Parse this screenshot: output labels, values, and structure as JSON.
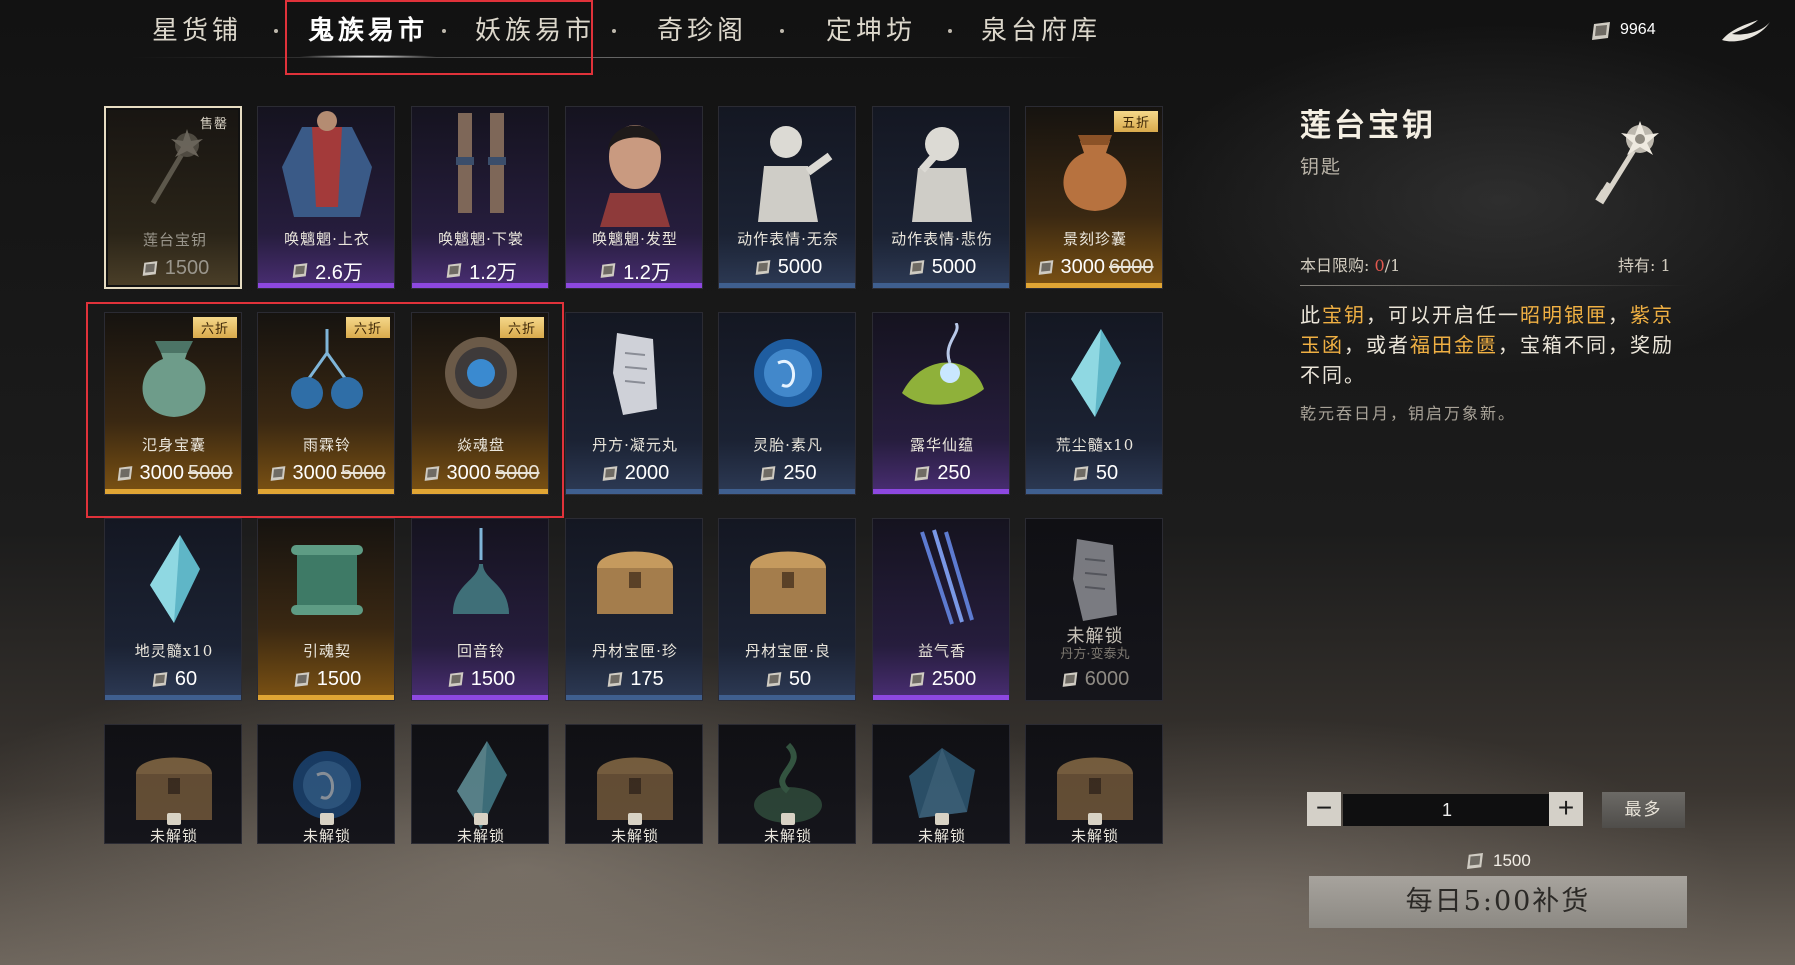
{
  "nav": {
    "tabs": [
      {
        "label": "星货铺"
      },
      {
        "label": "鬼族易市"
      },
      {
        "label": "妖族易市"
      },
      {
        "label": "奇珍阁"
      },
      {
        "label": "定坤坊"
      },
      {
        "label": "泉台府库"
      }
    ],
    "active_tab": "鬼族易市",
    "currency": "9964"
  },
  "grid": {
    "rows": [
      [
        {
          "name": "莲台宝钥",
          "price": "1500",
          "tag": "售罄",
          "rarity": "selected",
          "icon": "key-icon"
        },
        {
          "name": "唤魑魍·上衣",
          "price": "2.6万",
          "rarity": "purple",
          "icon": "outfit-top-icon"
        },
        {
          "name": "唤魑魍·下裳",
          "price": "1.2万",
          "rarity": "purple",
          "icon": "outfit-legs-icon"
        },
        {
          "name": "唤魑魍·发型",
          "price": "1.2万",
          "rarity": "purple",
          "icon": "hairstyle-icon"
        },
        {
          "name": "动作表情·无奈",
          "price": "5000",
          "rarity": "blue",
          "icon": "emote-icon"
        },
        {
          "name": "动作表情·悲伤",
          "price": "5000",
          "rarity": "blue",
          "icon": "emote-sad-icon"
        },
        {
          "name": "景刻珍囊",
          "price": "3000",
          "old_price": "6000",
          "tag": "五折",
          "rarity": "gold",
          "icon": "pouch-icon"
        }
      ],
      [
        {
          "name": "氾身宝囊",
          "price": "3000",
          "old_price": "5000",
          "tag": "六折",
          "rarity": "gold",
          "icon": "pouch-green-icon"
        },
        {
          "name": "雨霖铃",
          "price": "3000",
          "old_price": "5000",
          "tag": "六折",
          "rarity": "gold",
          "icon": "bell-orbs-icon"
        },
        {
          "name": "焱魂盘",
          "price": "3000",
          "old_price": "5000",
          "tag": "六折",
          "rarity": "gold",
          "icon": "disc-icon"
        },
        {
          "name": "丹方·凝元丸",
          "price": "2000",
          "rarity": "blue",
          "icon": "recipe-scroll-icon"
        },
        {
          "name": "灵胎·素凡",
          "price": "250",
          "rarity": "blue",
          "icon": "spirit-orb-icon"
        },
        {
          "name": "露华仙蕴",
          "price": "250",
          "rarity": "purple",
          "icon": "leaf-dew-icon"
        },
        {
          "name": "荒尘髓x10",
          "price": "50",
          "rarity": "blue",
          "icon": "crystal-icon"
        }
      ],
      [
        {
          "name": "地灵髓x10",
          "price": "60",
          "rarity": "blue",
          "icon": "crystal-icon"
        },
        {
          "name": "引魂契",
          "price": "1500",
          "rarity": "gold",
          "icon": "scroll-icon"
        },
        {
          "name": "回音铃",
          "price": "1500",
          "rarity": "purple",
          "icon": "bells-icon"
        },
        {
          "name": "丹材宝匣·珍",
          "price": "175",
          "rarity": "blue",
          "icon": "chest-icon"
        },
        {
          "name": "丹材宝匣·良",
          "price": "50",
          "rarity": "blue",
          "icon": "chest-icon"
        },
        {
          "name": "益气香",
          "price": "2500",
          "rarity": "purple",
          "icon": "incense-icon"
        },
        {
          "name": "未解锁",
          "sub": "丹方·变泰丸",
          "price": "6000",
          "rarity": "locked",
          "icon": "recipe-scroll-icon"
        }
      ],
      [
        {
          "name": "未解锁",
          "rarity": "dark",
          "icon": "chest-icon"
        },
        {
          "name": "未解锁",
          "rarity": "dark",
          "icon": "spirit-orb-icon"
        },
        {
          "name": "未解锁",
          "rarity": "dark",
          "icon": "crystal-icon"
        },
        {
          "name": "未解锁",
          "rarity": "dark",
          "icon": "chest-icon"
        },
        {
          "name": "未解锁",
          "rarity": "dark",
          "icon": "smoke-icon"
        },
        {
          "name": "未解锁",
          "rarity": "dark",
          "icon": "gem-icon"
        },
        {
          "name": "未解锁",
          "rarity": "dark",
          "icon": "chest-icon"
        }
      ]
    ]
  },
  "detail": {
    "title": "莲台宝钥",
    "category": "钥匙",
    "limit_label": "本日限购: ",
    "limit_value": "0",
    "limit_total": "/1",
    "own_label": "持有: 1",
    "desc_parts": [
      "此",
      "宝钥",
      "，可以开启任一",
      "昭明银匣",
      "，",
      "紫京玉函",
      "，或者",
      "福田金匮",
      "，宝箱不同，奖励不同。"
    ],
    "flavor": "乾元吞日月，钥启万象新。"
  },
  "purchase": {
    "minus": "−",
    "plus": "+",
    "quantity": "1",
    "max_label": "最多",
    "total": "1500",
    "button": "每日5:00补货"
  },
  "colors": {
    "highlight": "#f0b043",
    "annotation_box": "#e0323a",
    "gold": "#e0a534",
    "purple": "#8d48e0",
    "blue": "#3f5f8f"
  }
}
